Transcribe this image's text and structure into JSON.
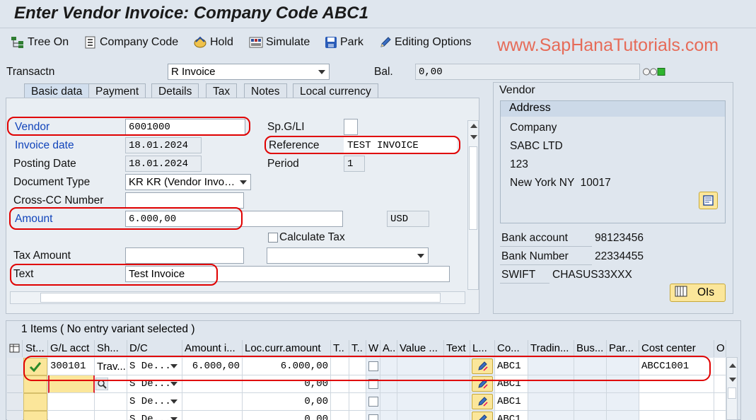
{
  "title": "Enter Vendor Invoice: Company Code ABC1",
  "watermark": "www.SapHanaTutorials.com",
  "toolbar": {
    "tree_on": "Tree On",
    "company_code": "Company Code",
    "hold": "Hold",
    "simulate": "Simulate",
    "park": "Park",
    "editing_options": "Editing Options"
  },
  "header": {
    "transactn_label": "Transactn",
    "transactn_value": "R Invoice",
    "bal_label": "Bal.",
    "bal_value": "0,00",
    "status_light": "green"
  },
  "tabs": [
    "Basic data",
    "Payment",
    "Details",
    "Tax",
    "Notes",
    "Local currency"
  ],
  "basic": {
    "vendor_label": "Vendor",
    "vendor_value": "6001000",
    "invoice_date_label": "Invoice date",
    "invoice_date_value": "18.01.2024",
    "posting_date_label": "Posting Date",
    "posting_date_value": "18.01.2024",
    "doc_type_label": "Document Type",
    "doc_type_value": "KR KR (Vendor Invo…",
    "crosscc_label": "Cross-CC Number",
    "crosscc_value": "",
    "amount_label": "Amount",
    "amount_value": "6.000,00",
    "currency_value": "USD",
    "calc_tax_label": "Calculate Tax",
    "tax_amount_label": "Tax Amount",
    "tax_amount_value": "",
    "tax_code_value": "",
    "text_label": "Text",
    "text_value": "Test Invoice",
    "spgl_label": "Sp.G/LI",
    "spgl_value": "",
    "reference_label": "Reference",
    "reference_value": "TEST INVOICE",
    "period_label": "Period",
    "period_value": "1"
  },
  "vendor": {
    "panel_title": "Vendor",
    "address_title": "Address",
    "line1": "Company",
    "line2": "SABC LTD",
    "line3": "123",
    "line4": "New York NY  10017",
    "bank_account_label": "Bank account",
    "bank_account_value": "98123456",
    "bank_number_label": "Bank Number",
    "bank_number_value": "22334455",
    "swift_label": "SWIFT",
    "swift_value": "CHASUS33XXX",
    "ois_label": "OIs"
  },
  "items": {
    "summary": "1 Items ( No entry variant selected )",
    "columns": [
      "St...",
      "G/L acct",
      "Sh...",
      "D/C",
      "Amount i...",
      "Loc.curr.amount",
      "T..",
      "T..",
      "W",
      "A..",
      "Value ...",
      "Text",
      "L...",
      "Co...",
      "Tradin...",
      "Bus...",
      "Par...",
      "Cost center",
      "O"
    ],
    "rows": [
      {
        "gl": "300101",
        "sh": "Trav...",
        "dc": "S De...",
        "amount": "6.000,00",
        "loc": "6.000,00",
        "co": "ABC1",
        "cost_center": "ABCC1001"
      },
      {
        "gl": "",
        "sh": "",
        "dc": "S De...",
        "amount": "",
        "loc": "0,00",
        "co": "ABC1",
        "cost_center": ""
      },
      {
        "gl": "",
        "sh": "",
        "dc": "S De...",
        "amount": "",
        "loc": "0,00",
        "co": "ABC1",
        "cost_center": ""
      },
      {
        "gl": "",
        "sh": "",
        "dc": "S De...",
        "amount": "",
        "loc": "0.00",
        "co": "ABC1",
        "cost_center": ""
      }
    ]
  }
}
